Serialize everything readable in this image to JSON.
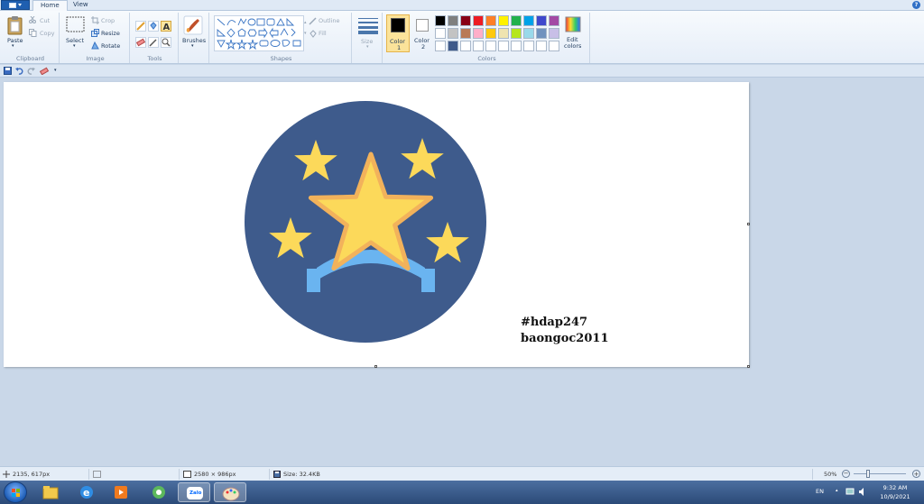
{
  "tabs": [
    {
      "label": "Home"
    },
    {
      "label": "View"
    }
  ],
  "ribbon": {
    "clipboard": {
      "paste": "Paste",
      "cut": "Cut",
      "copy": "Copy",
      "label": "Clipboard"
    },
    "image": {
      "select": "Select",
      "crop": "Crop",
      "resize": "Resize",
      "rotate": "Rotate",
      "label": "Image"
    },
    "tools": {
      "label": "Tools"
    },
    "brushes": {
      "label": "Brushes"
    },
    "shapes": {
      "outline": "Outline",
      "fill": "Fill",
      "label": "Shapes"
    },
    "size": {
      "label": "Size"
    },
    "colors": {
      "color1_label": "Color",
      "color1_num": "1",
      "color2_label": "Color",
      "color2_num": "2",
      "edit_label": "Edit",
      "edit_label2": "colors",
      "label": "Colors",
      "palette_row1": [
        "#000000",
        "#7f7f7f",
        "#880015",
        "#ed1c24",
        "#ff7f27",
        "#fff200",
        "#22b14c",
        "#00a2e8",
        "#3f48cc",
        "#a349a4"
      ],
      "palette_row2": [
        "#ffffff",
        "#c3c3c3",
        "#b97a57",
        "#ffaec9",
        "#ffc90e",
        "#efe4b0",
        "#b5e61d",
        "#99d9ea",
        "#7092be",
        "#c8bfe7"
      ],
      "palette_row3": [
        "#ffffff",
        "#3f5a8a",
        "#ffffff",
        "#ffffff",
        "#ffffff",
        "#ffffff",
        "#ffffff",
        "#ffffff",
        "#ffffff",
        "#ffffff"
      ]
    }
  },
  "canvas": {
    "caption_line1": "#hdap247",
    "caption_line2": "baongoc2011",
    "colors": {
      "circle": "#3e5b8c",
      "star": "#fcd95a",
      "star_outline": "#f2b25b",
      "banner": "#6ab4f0"
    }
  },
  "status": {
    "cursor_pos": "2135, 617px",
    "dimensions": "2580 × 986px",
    "size": "Size: 32.4KB",
    "zoom": "50%"
  },
  "taskbar": {
    "lang": "EN",
    "time": "9:32 AM",
    "date": "10/9/2021",
    "zalo_label": "Zalo"
  }
}
